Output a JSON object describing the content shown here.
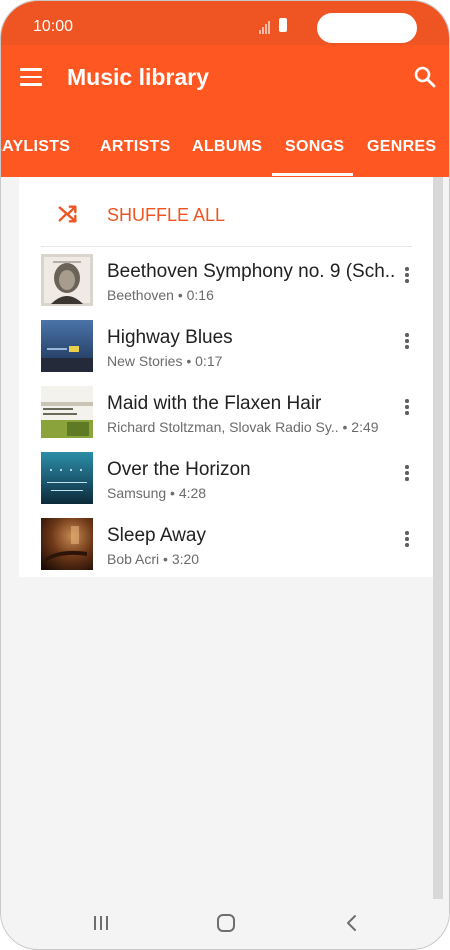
{
  "status_bar": {
    "time": "10:00"
  },
  "app_bar": {
    "title": "Music library"
  },
  "tabs": [
    {
      "label": "LAYLISTS",
      "selected": false
    },
    {
      "label": "ARTISTS",
      "selected": false
    },
    {
      "label": "ALBUMS",
      "selected": false
    },
    {
      "label": "SONGS",
      "selected": true
    },
    {
      "label": "GENRES",
      "selected": false
    }
  ],
  "shuffle": {
    "label": "SHUFFLE ALL"
  },
  "songs": [
    {
      "title": "Beethoven Symphony no. 9 (Sch..",
      "artist": "Beethoven",
      "duration": "0:16",
      "subtitle": "Beethoven • 0:16"
    },
    {
      "title": "Highway Blues",
      "artist": "New Stories",
      "duration": "0:17",
      "subtitle": "New Stories • 0:17"
    },
    {
      "title": "Maid with the Flaxen Hair",
      "artist": "Richard Stoltzman, Slovak Radio Sy..",
      "duration": "2:49",
      "subtitle": "Richard Stoltzman, Slovak Radio Sy..  • 2:49"
    },
    {
      "title": "Over the Horizon",
      "artist": "Samsung",
      "duration": "4:28",
      "subtitle": "Samsung • 4:28"
    },
    {
      "title": "Sleep Away",
      "artist": "Bob Acri",
      "duration": "3:20",
      "subtitle": "Bob Acri • 3:20"
    }
  ],
  "colors": {
    "accent": "#ff5722",
    "status_bar": "#ef5522"
  },
  "icons": [
    "menu-icon",
    "search-icon",
    "shuffle-icon",
    "more-vert-icon",
    "recent-apps-icon",
    "home-icon",
    "back-icon"
  ]
}
